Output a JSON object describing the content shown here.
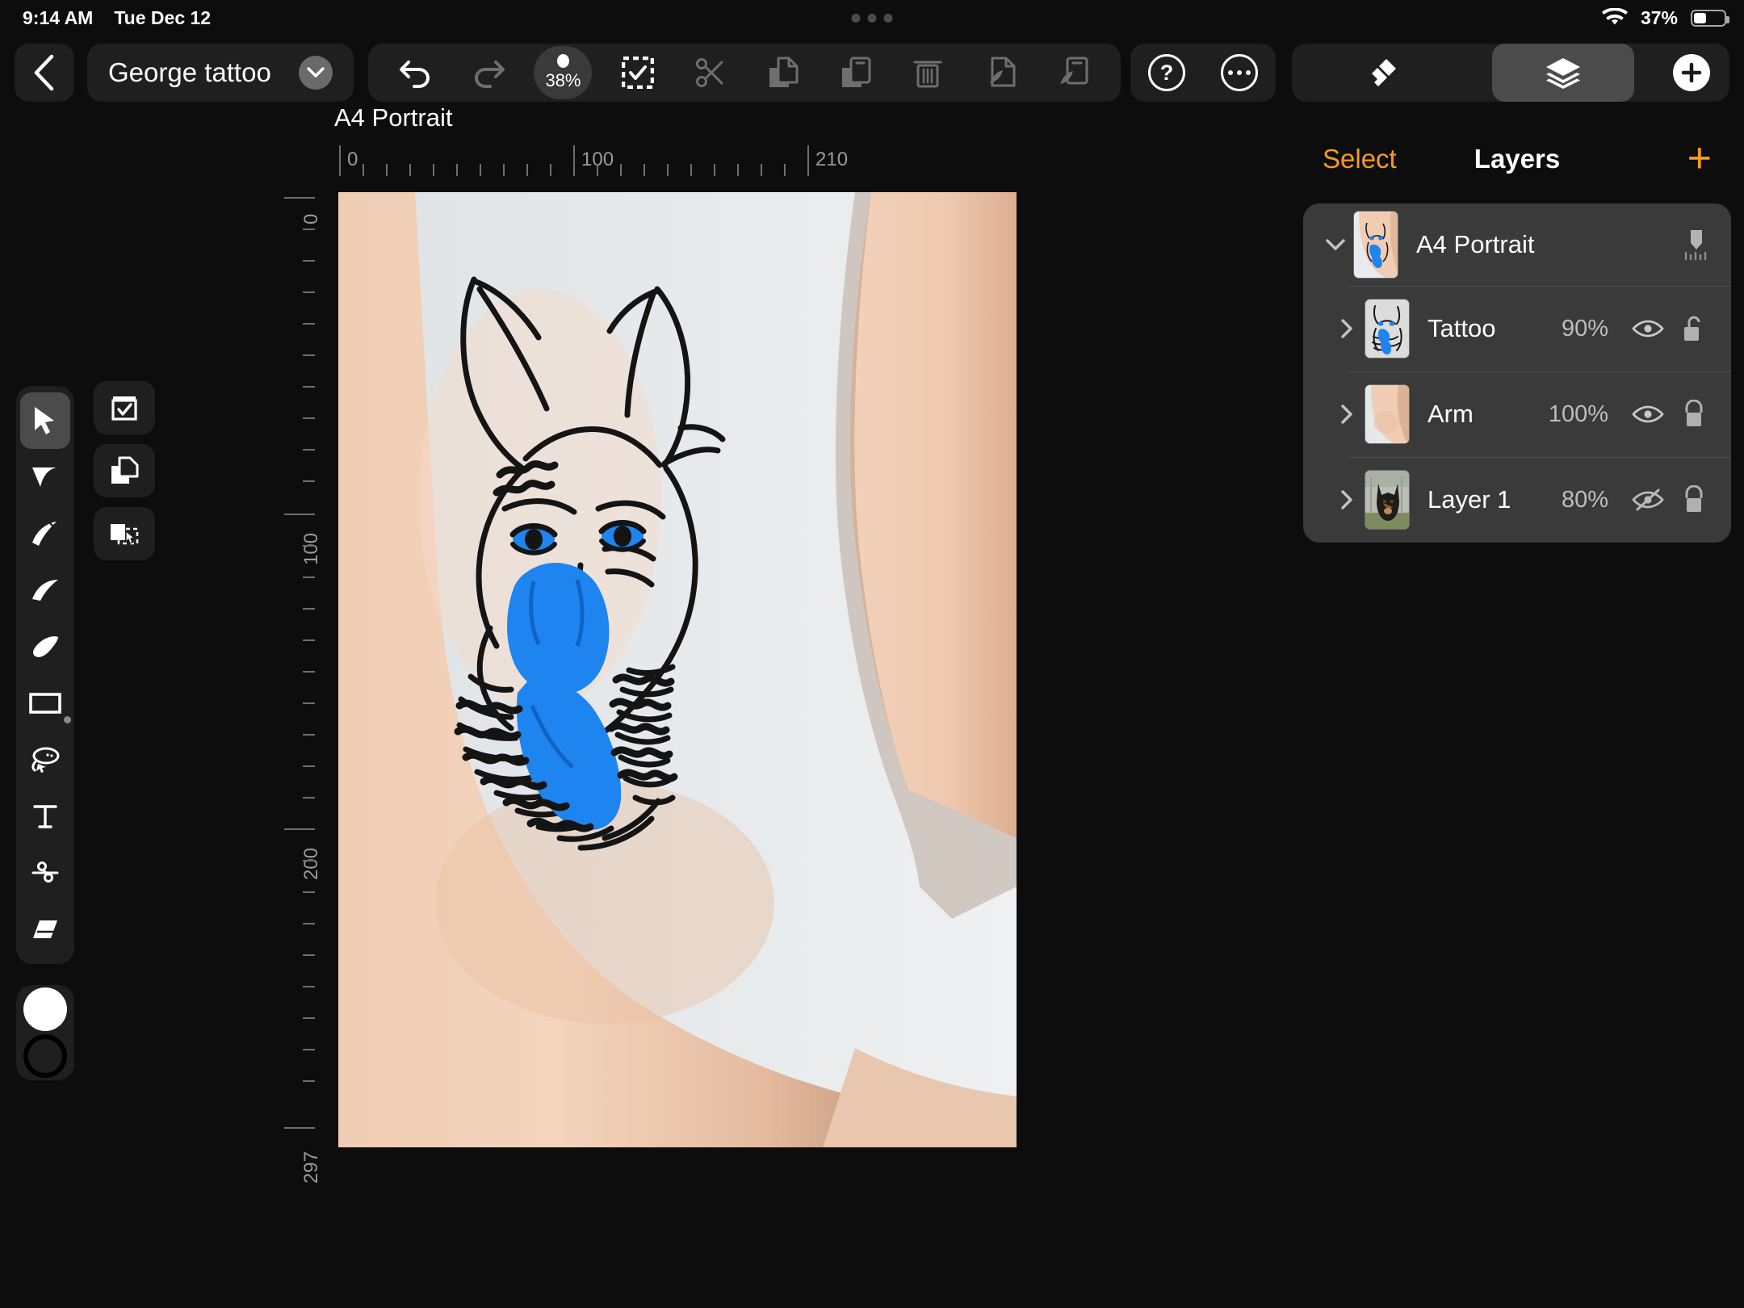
{
  "status_bar": {
    "time": "9:14 AM",
    "date": "Tue Dec 12",
    "wifi_icon": "wifi-icon",
    "battery_percent": "37%",
    "battery_icon": "battery-icon",
    "center_dots_icon": "dynamic-island-dots"
  },
  "top_bar": {
    "back_icon": "chevron-left-icon",
    "document_title": "George tattoo",
    "title_chevron_icon": "chevron-down-icon",
    "edit_tools": [
      {
        "name": "undo",
        "icon": "undo-arrow-icon",
        "enabled": true
      },
      {
        "name": "redo",
        "icon": "redo-arrow-icon",
        "enabled": false
      },
      {
        "name": "zoom",
        "icon": "zoom-level-pill",
        "value": "38%",
        "enabled": true
      },
      {
        "name": "select-all",
        "icon": "select-all-checkbox-icon",
        "enabled": true
      },
      {
        "name": "cut",
        "icon": "scissors-icon",
        "enabled": false
      },
      {
        "name": "copy",
        "icon": "copy-pages-icon",
        "enabled": false
      },
      {
        "name": "paste",
        "icon": "paste-icon",
        "enabled": false
      },
      {
        "name": "delete",
        "icon": "trash-icon",
        "enabled": false
      },
      {
        "name": "copy-style",
        "icon": "copy-style-icon",
        "enabled": false
      },
      {
        "name": "paste-style",
        "icon": "paste-style-icon",
        "enabled": false
      }
    ],
    "help_icon": "question-circle-icon",
    "more_icon": "ellipsis-circle-icon",
    "panel_tabs": [
      {
        "name": "styles",
        "icon": "brush-style-icon",
        "active": false
      },
      {
        "name": "layers",
        "icon": "layers-stack-icon",
        "active": true
      }
    ],
    "add_icon": "plus-circle-icon"
  },
  "tools": {
    "items": [
      {
        "name": "move-tool",
        "icon": "cursor-arrow-icon",
        "active": true
      },
      {
        "name": "node-tool",
        "icon": "node-arrow-icon",
        "active": false
      },
      {
        "name": "pen-tool",
        "icon": "pen-nib-icon",
        "active": false
      },
      {
        "name": "pencil-tool",
        "icon": "pencil-tip-icon",
        "active": false
      },
      {
        "name": "brush-tool",
        "icon": "paint-brush-icon",
        "active": false
      },
      {
        "name": "shape-tool",
        "icon": "rectangle-icon",
        "active": false
      },
      {
        "name": "lasso-tool",
        "icon": "lasso-select-icon",
        "active": false
      },
      {
        "name": "text-tool",
        "icon": "text-t-icon",
        "active": false
      },
      {
        "name": "knife-tool",
        "icon": "scissors-icon",
        "active": false
      },
      {
        "name": "eraser-tool",
        "icon": "eraser-icon",
        "active": false
      }
    ],
    "fill_swatch_icon": "fill-color-swatch",
    "stroke_swatch_icon": "stroke-color-swatch",
    "aux_items": [
      {
        "name": "snapping-button",
        "icon": "clipboard-check-icon"
      },
      {
        "name": "duplicate-button",
        "icon": "copy-pages-icon"
      },
      {
        "name": "transform-button",
        "icon": "transform-selection-icon"
      }
    ]
  },
  "canvas": {
    "artboard_label": "A4 Portrait",
    "ruler_h_labels": [
      "0",
      "100",
      "210"
    ],
    "ruler_v_labels": [
      "0",
      "100",
      "200",
      "297"
    ],
    "colors": {
      "tattoo_blue": "#1E84F0",
      "tattoo_ink": "#111111",
      "skin": "#e9c3a8",
      "background": "#e8eaec"
    }
  },
  "layers_panel": {
    "select_label": "Select",
    "title": "Layers",
    "add_icon": "plus-icon",
    "rows": [
      {
        "name": "A4 Portrait",
        "type": "artboard",
        "chevron_icon": "chevron-down-icon",
        "thumbnail_icon": "artboard-thumbnail",
        "right_icon": "artboard-ruler-icon",
        "opacity": "",
        "visible": true,
        "locked": false
      },
      {
        "name": "Tattoo",
        "type": "layer",
        "chevron_icon": "chevron-right-icon",
        "thumbnail_icon": "tattoo-thumbnail",
        "opacity": "90%",
        "visible": true,
        "visibility_icon": "eye-icon",
        "locked": false,
        "lock_icon": "unlock-icon"
      },
      {
        "name": "Arm",
        "type": "layer",
        "chevron_icon": "chevron-right-icon",
        "thumbnail_icon": "arm-thumbnail",
        "opacity": "100%",
        "visible": true,
        "visibility_icon": "eye-icon",
        "locked": true,
        "lock_icon": "lock-icon"
      },
      {
        "name": "Layer 1",
        "type": "layer",
        "chevron_icon": "chevron-right-icon",
        "thumbnail_icon": "dog-photo-thumbnail",
        "opacity": "80%",
        "visible": false,
        "visibility_icon": "eye-slash-icon",
        "locked": true,
        "lock_icon": "lock-icon"
      }
    ]
  }
}
